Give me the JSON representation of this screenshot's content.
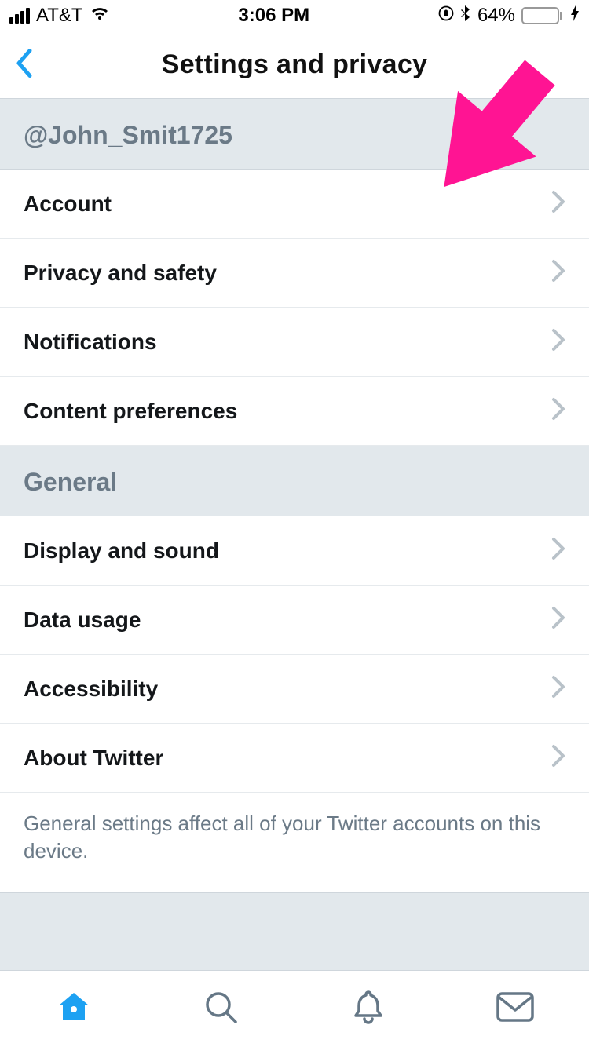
{
  "status": {
    "carrier": "AT&T",
    "time": "3:06 PM",
    "battery_pct": "64%"
  },
  "nav": {
    "title": "Settings and privacy"
  },
  "sections": {
    "user": {
      "handle": "@John_Smit1725",
      "rows": {
        "account": "Account",
        "privacy": "Privacy and safety",
        "notifications": "Notifications",
        "content": "Content preferences"
      }
    },
    "general": {
      "title": "General",
      "rows": {
        "display": "Display and sound",
        "data": "Data usage",
        "accessibility": "Accessibility",
        "about": "About Twitter"
      },
      "footnote": "General settings affect all of your Twitter accounts on this device."
    }
  },
  "overlay": {
    "arrow_color": "#ff1493"
  },
  "colors": {
    "accent": "#1DA1F2",
    "muted_icon": "#657786"
  }
}
